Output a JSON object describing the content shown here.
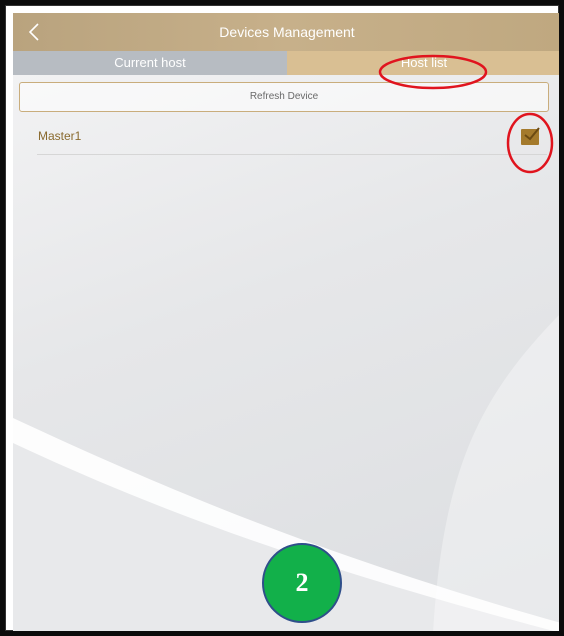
{
  "header": {
    "title": "Devices Management",
    "back_icon": "chevron-left-icon"
  },
  "tabs": [
    {
      "label": "Current host",
      "selected": false
    },
    {
      "label": "Host list",
      "selected": true
    }
  ],
  "refresh_button": {
    "label": "Refresh Device"
  },
  "devices": [
    {
      "name": "Master1",
      "checked": true
    }
  ],
  "annotations": {
    "step_number": "2",
    "highlight_color": "#e0141e",
    "badge_color": "#12b04a"
  },
  "colors": {
    "accent": "#c7b08a",
    "tab_selected": "#d9bf93",
    "tab_unselected": "#b7bcc2",
    "checkbox": "#a47a2c",
    "device_text": "#8a6a2e"
  }
}
